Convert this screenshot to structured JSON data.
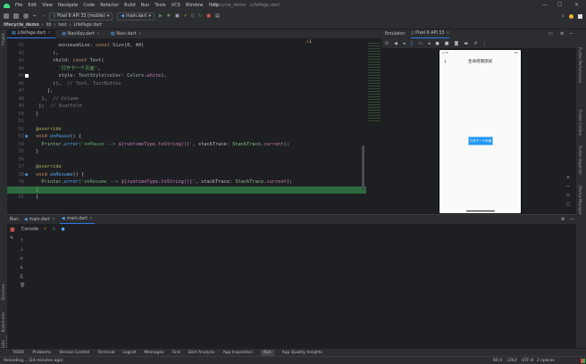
{
  "window": {
    "title": "lifecycle_demo - LifePage.dart",
    "minimize": "—",
    "maximize": "☐",
    "close": "✕"
  },
  "menu": [
    "File",
    "Edit",
    "View",
    "Navigate",
    "Code",
    "Refactor",
    "Build",
    "Run",
    "Tools",
    "VCS",
    "Window",
    "Help"
  ],
  "toolbar": {
    "device": "Pixel 6 API 33 (mobile)",
    "run_config": "main.dart"
  },
  "breadcrumb": [
    "lifecycle_demo",
    "lib",
    "test",
    "LifePage.dart"
  ],
  "editor_tabs": [
    {
      "label": "LifePage.dart",
      "active": true
    },
    {
      "label": "NaviKey.dart",
      "active": false
    },
    {
      "label": "Navi.dart",
      "active": false
    }
  ],
  "inspection": {
    "warnings": "1"
  },
  "code_lines": [
    {
      "n": "41",
      "seg": [
        [
          "        minimumSize: ",
          "pl"
        ],
        [
          "const ",
          "kw"
        ],
        [
          "Size",
          "cls"
        ],
        [
          "(0, 40)",
          "pl"
        ]
      ]
    },
    {
      "n": "42",
      "seg": [
        [
          "      ),",
          "pl"
        ]
      ]
    },
    {
      "n": "43",
      "seg": [
        [
          "      child: ",
          "pl"
        ],
        [
          "const ",
          "kw"
        ],
        [
          "Text",
          "cls"
        ],
        [
          "(",
          "pl"
        ]
      ]
    },
    {
      "n": "44",
      "seg": [
        [
          "        '打开下一个页面'",
          "str"
        ],
        [
          ",",
          "pl"
        ]
      ]
    },
    {
      "n": "45",
      "seg": [
        [
          "        style: ",
          "pl"
        ],
        [
          "TextStyle",
          "cls"
        ],
        [
          "(color: ",
          "pl"
        ],
        [
          "Colors",
          "cls"
        ],
        [
          ".",
          "pl"
        ],
        [
          "white",
          "it"
        ],
        [
          "),",
          "pl"
        ]
      ]
    },
    {
      "n": "46",
      "seg": [
        [
          "      )),  ",
          "pl"
        ],
        [
          "// Text, TextButton",
          "cm"
        ]
      ]
    },
    {
      "n": "47",
      "seg": [
        [
          "    ],",
          "pl"
        ]
      ]
    },
    {
      "n": "48",
      "seg": [
        [
          "  ),  ",
          "pl"
        ],
        [
          "// Column",
          "cm"
        ]
      ]
    },
    {
      "n": "49",
      "seg": [
        [
          " );  ",
          "pl"
        ],
        [
          "// Scaffold",
          "cm"
        ]
      ]
    },
    {
      "n": "50",
      "seg": [
        [
          "}",
          "pl"
        ]
      ]
    },
    {
      "n": "51",
      "seg": []
    },
    {
      "n": "52",
      "seg": [
        [
          "@override",
          "an"
        ]
      ]
    },
    {
      "n": "53",
      "seg": [
        [
          "void ",
          "kw"
        ],
        [
          "onPause",
          "fn"
        ],
        [
          "() {",
          "pl"
        ]
      ]
    },
    {
      "n": "54",
      "seg": [
        [
          "  Printer",
          "gr"
        ],
        [
          ".",
          "pl"
        ],
        [
          "error",
          "fn"
        ],
        [
          "('onPause --> ",
          "str"
        ],
        [
          "${runtimeType.toString()}",
          "it"
        ],
        [
          "'",
          "str"
        ],
        [
          ", stackTrace: ",
          "pl"
        ],
        [
          "StackTrace",
          "gr"
        ],
        [
          ".",
          "pl"
        ],
        [
          "current",
          "it"
        ],
        [
          ");",
          "pl"
        ]
      ]
    },
    {
      "n": "55",
      "seg": [
        [
          "}",
          "pl"
        ]
      ]
    },
    {
      "n": "56",
      "seg": []
    },
    {
      "n": "57",
      "seg": [
        [
          "@override",
          "an"
        ]
      ]
    },
    {
      "n": "58",
      "seg": [
        [
          "void ",
          "kw"
        ],
        [
          "onResume",
          "fn"
        ],
        [
          "() {",
          "pl"
        ]
      ]
    },
    {
      "n": "59",
      "seg": [
        [
          "  Printer",
          "gr"
        ],
        [
          ".",
          "pl"
        ],
        [
          "error",
          "fn"
        ],
        [
          "('onResume --> ",
          "str"
        ],
        [
          "${runtimeType.toString()}",
          "it"
        ],
        [
          "'",
          "str"
        ],
        [
          ", stackTrace: ",
          "pl"
        ],
        [
          "StackTrace",
          "gr"
        ],
        [
          ".",
          "pl"
        ],
        [
          "current",
          "it"
        ],
        [
          ");",
          "pl"
        ]
      ]
    },
    {
      "n": "60",
      "seg": [
        [
          "}",
          "an"
        ]
      ],
      "highlight": true
    },
    {
      "n": "61",
      "seg": [
        [
          "}",
          "pl"
        ]
      ]
    }
  ],
  "emulator": {
    "label": "Emulator:",
    "device_tab": "Pixel 6 API 33"
  },
  "phone": {
    "time": "2:16",
    "signal": "5G",
    "app_title": "生命周期测试",
    "back": "‹",
    "button": "打开下一个页面"
  },
  "right_tools": [
    "Flutter Performance",
    "Flutter Outline",
    "Flutter Inspector",
    "Device Manager"
  ],
  "left_tools": [
    "Project",
    "Structure",
    "Bookmarks",
    "Build Variants"
  ],
  "run": {
    "label": "Run:",
    "tabs": [
      "main.dart",
      "main.dart"
    ],
    "console": "Console"
  },
  "bottom_tabs": [
    "TODO",
    "Problems",
    "Version Control",
    "Terminal",
    "Logcat",
    "Messages",
    "Find",
    "Dart Analysis",
    "App Inspection",
    "Run",
    "App Quality Insights"
  ],
  "status": {
    "message": "Reloading... (24 minutes ago)",
    "position": "60:4",
    "line_sep": "CRLF",
    "encoding": "UTF-8",
    "indent": "2 spaces"
  },
  "colors": {
    "accent": "#3574f0",
    "highlight": "#2d6a3f",
    "button": "#2196f3"
  }
}
